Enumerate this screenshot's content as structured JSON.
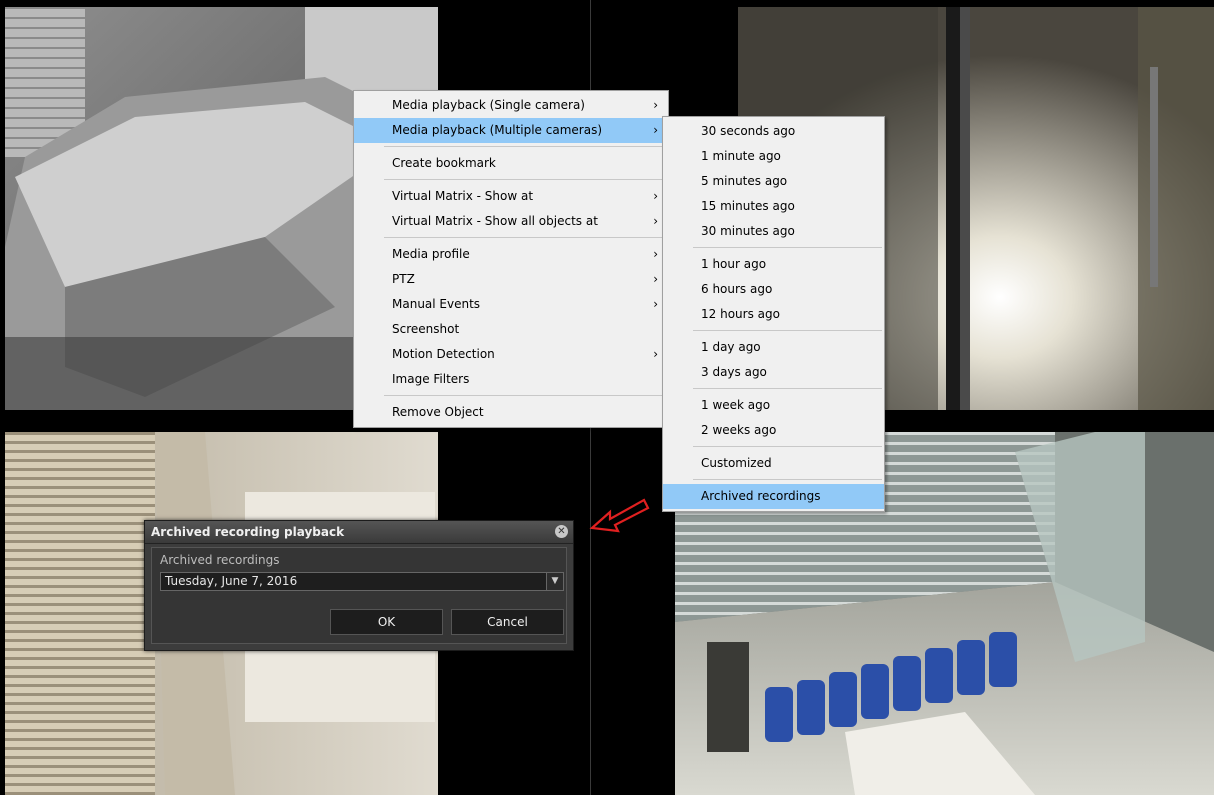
{
  "context_menu": {
    "items": [
      {
        "label": "Media playback (Single camera)",
        "submenu": true
      },
      {
        "label": "Media playback (Multiple cameras)",
        "submenu": true,
        "highlighted": true
      },
      {
        "separator": true
      },
      {
        "label": "Create bookmark"
      },
      {
        "separator": true
      },
      {
        "label": "Virtual Matrix - Show at",
        "submenu": true
      },
      {
        "label": "Virtual Matrix - Show all objects at",
        "submenu": true
      },
      {
        "separator": true
      },
      {
        "label": "Media profile",
        "submenu": true
      },
      {
        "label": "PTZ",
        "submenu": true
      },
      {
        "label": "Manual Events",
        "submenu": true
      },
      {
        "label": "Screenshot"
      },
      {
        "label": "Motion Detection",
        "submenu": true
      },
      {
        "label": "Image Filters"
      },
      {
        "separator": true
      },
      {
        "label": "Remove Object"
      }
    ]
  },
  "submenu": {
    "items": [
      {
        "label": "30 seconds ago"
      },
      {
        "label": "1 minute ago"
      },
      {
        "label": "5 minutes ago"
      },
      {
        "label": "15 minutes ago"
      },
      {
        "label": "30 minutes ago"
      },
      {
        "separator": true
      },
      {
        "label": "1 hour ago"
      },
      {
        "label": "6 hours ago"
      },
      {
        "label": "12 hours ago"
      },
      {
        "separator": true
      },
      {
        "label": "1 day ago"
      },
      {
        "label": "3 days ago"
      },
      {
        "separator": true
      },
      {
        "label": "1 week ago"
      },
      {
        "label": "2 weeks ago"
      },
      {
        "separator": true
      },
      {
        "label": "Customized"
      },
      {
        "separator": true
      },
      {
        "label": "Archived recordings",
        "highlighted": true
      }
    ]
  },
  "dialog": {
    "title": "Archived recording playback",
    "field_label": "Archived recordings",
    "selected_date": "Tuesday, June 7, 2016",
    "ok_label": "OK",
    "cancel_label": "Cancel"
  },
  "colors": {
    "menu_highlight": "#91c9f7",
    "arrow_red": "#e02020"
  },
  "icons": {
    "submenu_arrow": "chevron-right-icon",
    "close": "close-circle-icon",
    "dropdown": "dropdown-triangle-icon",
    "annotation": "red-arrow-icon"
  }
}
